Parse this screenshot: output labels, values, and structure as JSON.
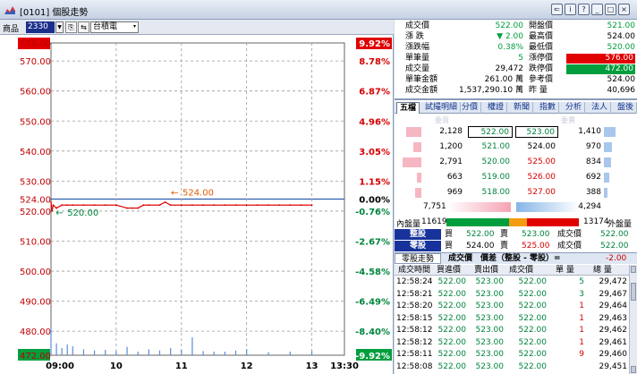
{
  "window": {
    "title": "[0101] 個股走勢",
    "buttons": [
      "⇐",
      "i",
      "?",
      "_",
      "□",
      "×"
    ]
  },
  "toolbar": {
    "label": "商品",
    "code": "2330",
    "name": "台積電"
  },
  "chart_data": {
    "type": "line",
    "title": "",
    "xlabel": "",
    "ylabel": "",
    "ylim": [
      472,
      576
    ],
    "reference_price": 524.0,
    "y_ticks_left": [
      "576.00",
      "570.00",
      "560.00",
      "550.00",
      "540.00",
      "530.00",
      "524.00",
      "520.00",
      "510.00",
      "500.00",
      "490.00",
      "480.00",
      "472.00"
    ],
    "y_ticks_right": [
      "9.92%",
      "8.78%",
      "6.87%",
      "4.96%",
      "3.05%",
      "1.15%",
      "0.00%",
      "-0.76%",
      "-2.67%",
      "-4.58%",
      "-6.49%",
      "-8.40%",
      "-9.92%"
    ],
    "x_ticks": [
      "09:00",
      "10",
      "11",
      "12",
      "13",
      "13:30"
    ],
    "annotations": [
      {
        "label": "524.00",
        "kind": "high",
        "time": "10:47",
        "value": 524.0
      },
      {
        "label": "520.00",
        "kind": "low",
        "time": "09:01",
        "value": 520.0
      }
    ],
    "series": [
      {
        "x": [
          "09:00",
          "09:01",
          "09:02",
          "09:05",
          "09:10",
          "09:15",
          "09:20",
          "09:30",
          "09:40",
          "09:50",
          "10:00",
          "10:10",
          "10:15",
          "10:20",
          "10:25",
          "10:30",
          "10:40",
          "10:45",
          "10:50",
          "11:00",
          "11:10",
          "11:20",
          "11:30",
          "11:40",
          "11:50",
          "12:00",
          "12:10",
          "12:20",
          "12:30",
          "12:40",
          "12:50",
          "13:00"
        ],
        "values": [
          523,
          520,
          522,
          521,
          522,
          522,
          522,
          522,
          522,
          522,
          522,
          521,
          521,
          521,
          522,
          522,
          522,
          523,
          522,
          522,
          522,
          522,
          522,
          522,
          522,
          522,
          522,
          522,
          522,
          522,
          522,
          522
        ]
      }
    ],
    "volume": {
      "x": [
        "09:00",
        "09:05",
        "09:10",
        "09:15",
        "09:20",
        "09:30",
        "09:40",
        "09:50",
        "10:00",
        "10:10",
        "10:20",
        "10:30",
        "10:40",
        "10:50",
        "11:00",
        "11:10",
        "11:20",
        "11:30",
        "11:40",
        "11:50",
        "12:00",
        "12:20",
        "12:40",
        "13:00"
      ],
      "values": [
        45,
        20,
        12,
        18,
        15,
        10,
        8,
        9,
        7,
        14,
        6,
        10,
        8,
        12,
        9,
        30,
        7,
        6,
        6,
        8,
        10,
        5,
        6,
        7
      ]
    }
  },
  "quote": [
    {
      "k1": "成交價",
      "v1": "522.00",
      "c1": "#009e3d",
      "k2": "開盤價",
      "v2": "521.00",
      "c2": "#009e3d",
      "bg2": ""
    },
    {
      "k1": "漲 跌",
      "v1": "▼ 2.00",
      "c1": "#009e3d",
      "k2": "最高價",
      "v2": "524.00",
      "c2": "#000000",
      "bg2": ""
    },
    {
      "k1": "漲跌幅",
      "v1": "0.38%",
      "c1": "#009e3d",
      "k2": "最低價",
      "v2": "520.00",
      "c2": "#009e3d",
      "bg2": ""
    },
    {
      "k1": "單筆量",
      "v1": "5",
      "c1": "#009e3d",
      "k2": "漲停價",
      "v2": "576.00",
      "c2": "#ffffff",
      "bg2": "#e00000"
    },
    {
      "k1": "成交量",
      "v1": "29,472",
      "c1": "#000000",
      "k2": "跌停價",
      "v2": "472.00",
      "c2": "#ffffff",
      "bg2": "#009e3d"
    },
    {
      "k1": "單筆金額",
      "v1": "261.00 萬",
      "c1": "#000000",
      "k2": "參考價",
      "v2": "524.00",
      "c2": "#000000",
      "bg2": ""
    },
    {
      "k1": "成交金額",
      "v1": "1,537,290.10 萬",
      "c1": "#000000",
      "k2": "昨 量",
      "v2": "40,696",
      "c2": "#000000",
      "bg2": ""
    }
  ],
  "tabs": [
    "五檔",
    "試撮明細",
    "分價",
    "權證",
    "新聞",
    "指數",
    "分析",
    "法人",
    "盤後"
  ],
  "book": {
    "bid_header": "委買",
    "ask_header": "委賣",
    "rows": [
      {
        "bid_vol": "2,128",
        "bid": "522.00",
        "ask": "523.00",
        "ask_vol": "1,410",
        "bid_fill": 0.75,
        "ask_fill": 0.6
      },
      {
        "bid_vol": "1,200",
        "bid": "521.00",
        "ask": "524.00",
        "ask_vol": "970",
        "bid_fill": 0.4,
        "ask_fill": 0.4
      },
      {
        "bid_vol": "2,791",
        "bid": "520.00",
        "ask": "525.00",
        "ask_vol": "834",
        "bid_fill": 0.95,
        "ask_fill": 0.35
      },
      {
        "bid_vol": "663",
        "bid": "519.00",
        "ask": "526.00",
        "ask_vol": "692",
        "bid_fill": 0.22,
        "ask_fill": 0.28
      },
      {
        "bid_vol": "969",
        "bid": "518.00",
        "ask": "527.00",
        "ask_vol": "388",
        "bid_fill": 0.33,
        "ask_fill": 0.16
      }
    ],
    "bid_total": "7,751",
    "ask_total": "4,294"
  },
  "inout": {
    "in_label": "內盤量",
    "in_value": "11619",
    "out_value": "13174",
    "out_label": "外盤量",
    "in_ratio": 0.47
  },
  "oddlot": [
    {
      "key": "整股",
      "buy_k": "買",
      "buy_v": "522.00",
      "sell_k": "賣",
      "sell_v": "523.00",
      "px_k": "成交價",
      "px_v": "522.00"
    },
    {
      "key": "零股",
      "buy_k": "買",
      "buy_v": "524.00",
      "sell_k": "賣",
      "sell_v": "525.00",
      "px_k": "成交價",
      "px_v": "522.00"
    }
  ],
  "oddbar": {
    "tab": "零股走勢",
    "k1": "成交價",
    "k2": "價差（整股 - 零股）=",
    "value": "-2.00"
  },
  "ticks": {
    "headers": [
      "成交時間",
      "買進價",
      "賣出價",
      "成交價",
      "單 量",
      "總 量"
    ],
    "rows": [
      {
        "time": "12:58:24",
        "bid": "522.00",
        "ask": "523.00",
        "px": "522.00",
        "vol": "5",
        "total": "29,472"
      },
      {
        "time": "12:58:21",
        "bid": "522.00",
        "ask": "523.00",
        "px": "522.00",
        "vol": "3",
        "total": "29,467"
      },
      {
        "time": "12:58:20",
        "bid": "522.00",
        "ask": "523.00",
        "px": "522.00",
        "vol": "1",
        "total": "29,464"
      },
      {
        "time": "12:58:15",
        "bid": "522.00",
        "ask": "523.00",
        "px": "522.00",
        "vol": "1",
        "total": "29,463"
      },
      {
        "time": "12:58:12",
        "bid": "522.00",
        "ask": "523.00",
        "px": "522.00",
        "vol": "1",
        "total": "29,462"
      },
      {
        "time": "12:58:12",
        "bid": "522.00",
        "ask": "523.00",
        "px": "522.00",
        "vol": "1",
        "total": "29,461"
      },
      {
        "time": "12:58:11",
        "bid": "522.00",
        "ask": "523.00",
        "px": "522.00",
        "vol": "9",
        "total": "29,460"
      },
      {
        "time": "12:58:08",
        "bid": "522.00",
        "ask": "523.00",
        "px": "522.00",
        "vol": "",
        "total": "29,451"
      }
    ]
  }
}
